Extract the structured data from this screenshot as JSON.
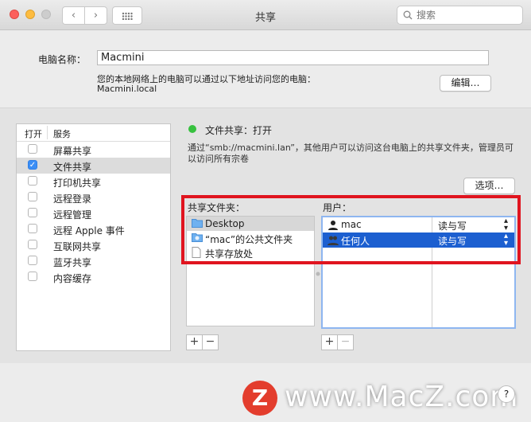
{
  "window": {
    "title": "共享"
  },
  "search": {
    "placeholder": "搜索"
  },
  "computer": {
    "label": "电脑名称：",
    "name": "Macmini",
    "address_note": "您的本地网络上的电脑可以通过以下地址访问您的电脑：",
    "address": "Macmini.local",
    "edit_button": "编辑…"
  },
  "services": {
    "col_on": "打开",
    "col_service": "服务",
    "items": [
      {
        "label": "屏幕共享",
        "checked": false
      },
      {
        "label": "文件共享",
        "checked": true,
        "selected": true
      },
      {
        "label": "打印机共享",
        "checked": false
      },
      {
        "label": "远程登录",
        "checked": false
      },
      {
        "label": "远程管理",
        "checked": false
      },
      {
        "label": "远程 Apple 事件",
        "checked": false
      },
      {
        "label": "互联网共享",
        "checked": false
      },
      {
        "label": "蓝牙共享",
        "checked": false
      },
      {
        "label": "内容缓存",
        "checked": false
      }
    ]
  },
  "file_sharing": {
    "status": "文件共享：打开",
    "description": "通过“smb://macmini.lan”，其他用户可以访问这台电脑上的共享文件夹，管理员可以访问所有宗卷",
    "options_button": "选项…",
    "shared_folders_label": "共享文件夹：",
    "shared_folders": [
      "Desktop",
      "“mac”的公共文件夹",
      "共享存放处"
    ],
    "users_label": "用户：",
    "users": [
      {
        "name": "mac",
        "permission": "读与写"
      },
      {
        "name": "任何人",
        "permission": "读与写"
      }
    ],
    "add": "+",
    "remove": "−"
  },
  "watermark": {
    "logo": "Z",
    "text": "www.MacZ.com"
  },
  "help": "?",
  "colors": {
    "highlight": "#1c5fd0",
    "status_on": "#37c13f",
    "annotation": "#e0141f"
  }
}
